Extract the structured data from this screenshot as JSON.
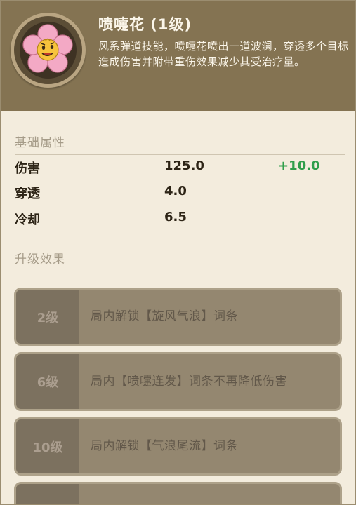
{
  "skill": {
    "title": "喷嚏花 (1级)",
    "description": "风系弹道技能，喷嚏花喷出一道波澜，穿透多个目标造成伤害并附带重伤效果减少其受治疗量。",
    "icon": "sneeze-flower-icon"
  },
  "base_stats": {
    "section_title": "基础属性",
    "rows": [
      {
        "label": "伤害",
        "value": "125.0",
        "bonus": "+10.0"
      },
      {
        "label": "穿透",
        "value": "4.0",
        "bonus": ""
      },
      {
        "label": "冷却",
        "value": "6.5",
        "bonus": ""
      }
    ]
  },
  "upgrades": {
    "section_title": "升级效果",
    "items": [
      {
        "level": "2级",
        "effect": "局内解锁【旋风气浪】词条"
      },
      {
        "level": "6级",
        "effect": "局内【喷嚏连发】词条不再降低伤害"
      },
      {
        "level": "10级",
        "effect": "局内解锁【气浪尾流】词条"
      },
      {
        "level": "",
        "effect": ""
      }
    ]
  },
  "colors": {
    "header_bg": "#847352",
    "page_bg": "#f3ecdd",
    "bonus_green": "#2f9e4a"
  }
}
